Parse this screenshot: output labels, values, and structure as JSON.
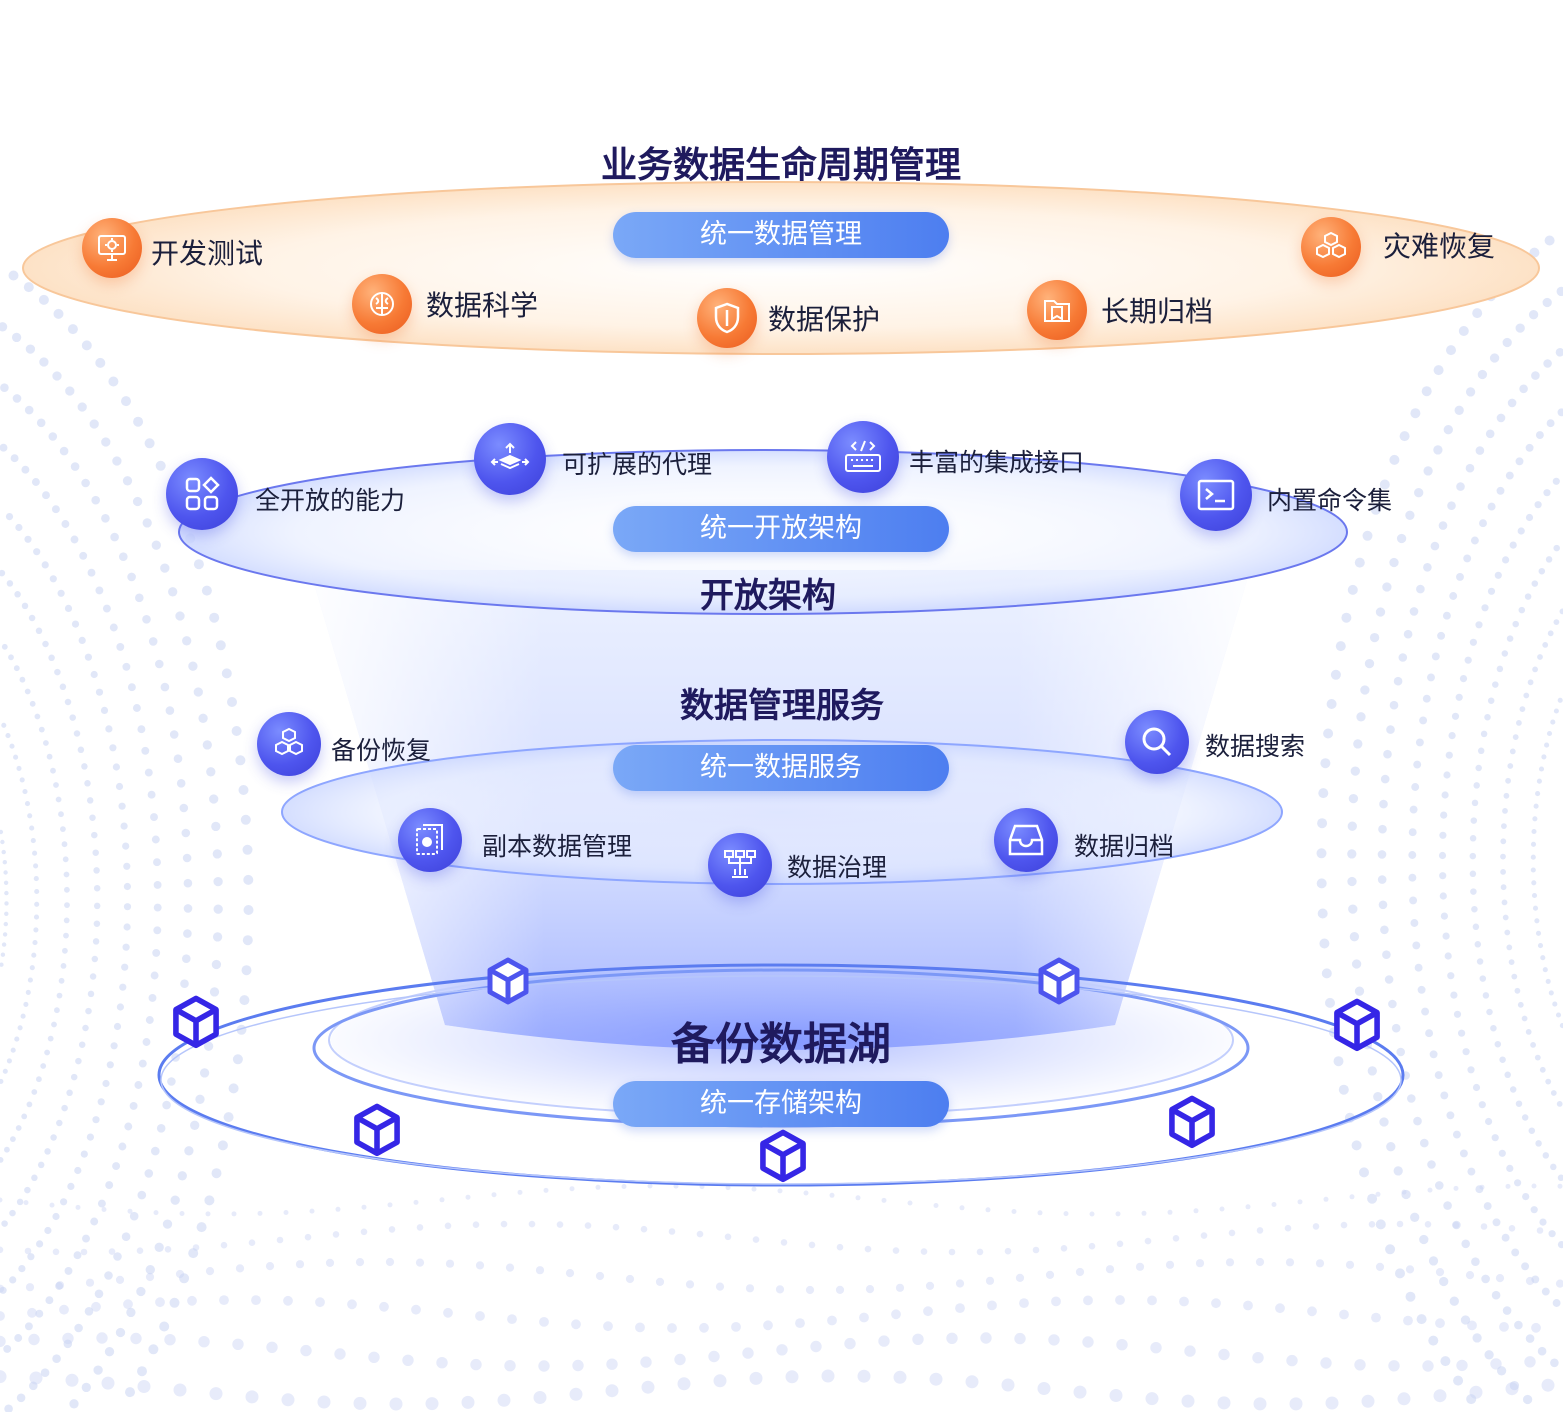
{
  "colors": {
    "title": "#1f1a5e",
    "pill_start": "#7aa8f7",
    "pill_end": "#4d7ef0",
    "orange_accent": "#f77a35",
    "blue_accent": "#4e55ee",
    "cube": "#3526e6",
    "ring": "#4c6ff0"
  },
  "layer_lifecycle": {
    "title": "业务数据生命周期管理",
    "pill": "统一数据管理",
    "items": [
      {
        "label": "开发测试",
        "icon": "monitor-gear-icon"
      },
      {
        "label": "数据科学",
        "icon": "brain-gear-icon"
      },
      {
        "label": "数据保护",
        "icon": "shield-icon"
      },
      {
        "label": "长期归档",
        "icon": "archive-folder-icon"
      },
      {
        "label": "灾难恢复",
        "icon": "cubes-icon"
      }
    ]
  },
  "layer_open": {
    "title": "开放架构",
    "pill": "统一开放架构",
    "items": [
      {
        "label": "全开放的能力",
        "icon": "grid-apps-icon"
      },
      {
        "label": "可扩展的代理",
        "icon": "layers-arrows-icon"
      },
      {
        "label": "丰富的集成接口",
        "icon": "keyboard-code-icon"
      },
      {
        "label": "内置命令集",
        "icon": "terminal-icon"
      }
    ]
  },
  "layer_service": {
    "title": "数据管理服务",
    "pill": "统一数据服务",
    "items": [
      {
        "label": "备份恢复",
        "icon": "stacked-cubes-icon"
      },
      {
        "label": "数据搜索",
        "icon": "magnifier-icon"
      },
      {
        "label": "副本数据管理",
        "icon": "copy-gear-icon"
      },
      {
        "label": "数据治理",
        "icon": "hierarchy-icon"
      },
      {
        "label": "数据归档",
        "icon": "inbox-icon"
      }
    ]
  },
  "layer_lake": {
    "title": "备份数据湖",
    "pill": "统一存储架构"
  }
}
